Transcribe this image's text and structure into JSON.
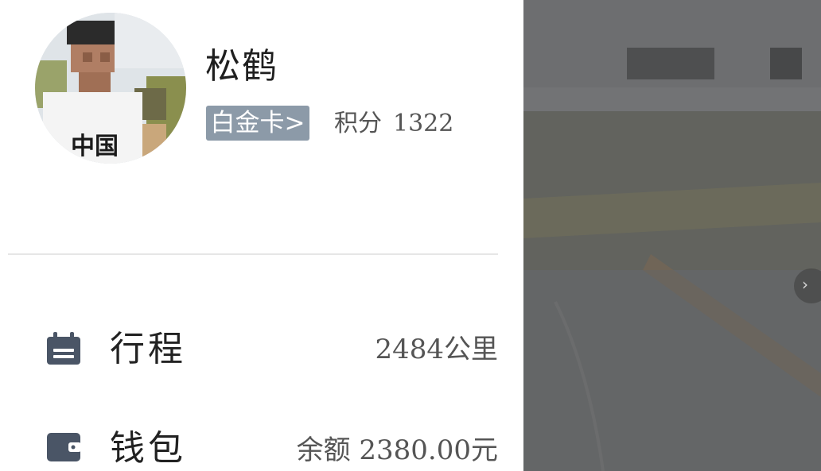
{
  "profile": {
    "username": "松鹤",
    "tier_label": "白金卡>",
    "points_label": "积分",
    "points_value": "1322"
  },
  "menu": {
    "trips": {
      "label": "行程",
      "value": "2484公里",
      "icon": "calendar-icon"
    },
    "wallet": {
      "label": "钱包",
      "value": "余额 2380.00元",
      "icon": "wallet-icon"
    }
  },
  "map": {
    "next_button_glyph": "›"
  },
  "colors": {
    "badge_bg": "#8c9aa8",
    "icon_color": "#4a5566",
    "scrim": "#6e6f70"
  }
}
